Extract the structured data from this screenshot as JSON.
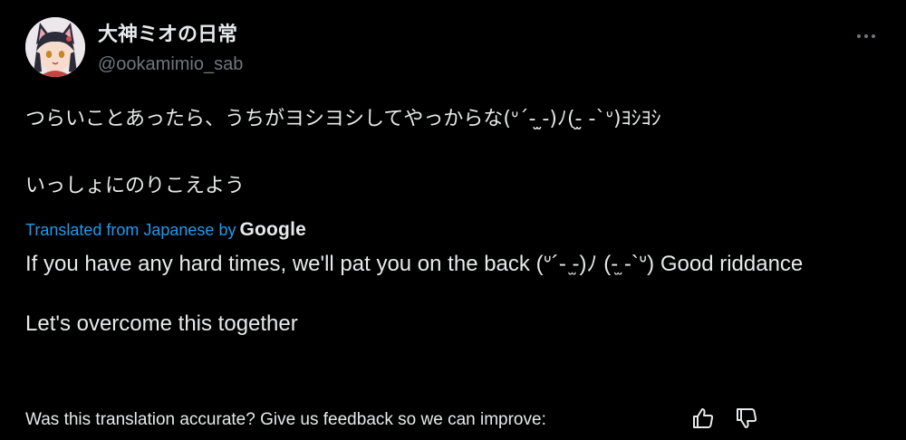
{
  "author": {
    "display_name": "大神ミオの日常",
    "handle": "@ookamimio_sab"
  },
  "post": {
    "original_lines": [
      "つらいことあったら、うちがヨシヨシしてやっからな(ᐡ´- ̫-)ﾉ(-̫ -`ᐡ)ﾖｼﾖｼ",
      "いっしょにのりこえよう"
    ],
    "translated_prefix": "Translated from Japanese by",
    "translator_brand": "Google",
    "translation_lines": [
      "If you have any hard times, we'll pat you on the back (ᐡ´- ̫-)ﾉ (-̫ -`ᐡ) Good riddance",
      "Let's overcome this together"
    ]
  },
  "feedback": {
    "prompt": "Was this translation accurate? Give us feedback so we can improve:"
  },
  "icons": {
    "more": "more-dots-icon",
    "thumbs_up": "thumbs-up-icon",
    "thumbs_down": "thumbs-down-icon"
  },
  "colors": {
    "background": "#000000",
    "text": "#e7e9ea",
    "secondary": "#71767b",
    "link": "#1d9bf0"
  }
}
